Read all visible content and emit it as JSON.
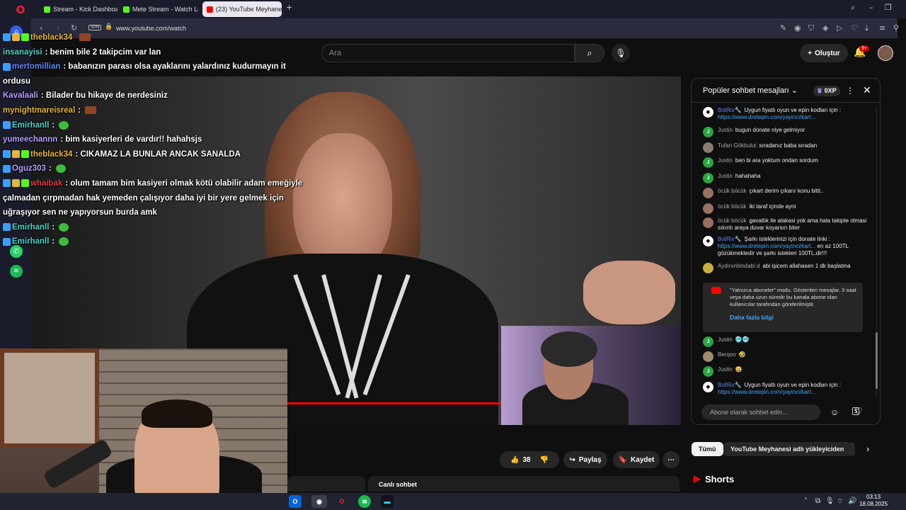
{
  "browser": {
    "tabs": [
      {
        "label": "Stream - Kick Dashboard",
        "favicon_color": "#53fc18"
      },
      {
        "label": "Mete Stream - Watch Live",
        "favicon_color": "#53fc18"
      },
      {
        "label": "(23) YouTube Meyhanesi",
        "favicon_color": "#ff0000"
      }
    ],
    "new_tab": "+",
    "vpn": "VPN",
    "url": "www.youtube.com/watch"
  },
  "youtube": {
    "search_placeholder": "Ara",
    "create_label": "Oluştur",
    "notif_badge": "9+",
    "like_count": "38",
    "share_label": "Paylaş",
    "save_label": "Kaydet",
    "live_chat_label": "Canlı sohbet",
    "pills": [
      "Tümü",
      "YouTube Meyhanesi adlı yükleyiciden"
    ],
    "shorts_label": "Shorts"
  },
  "chat": {
    "title": "Popüler sohbet mesajları",
    "xp": "0XP",
    "input_placeholder": "Abone olarak sohbet edin...",
    "notice": "\"Yalnızca aboneler\" modu. Gösterilen mesajlar, 3 saat veya daha uzun süredir bu kanala abone olan kullanıcılar tarafından gönderilmiştir.",
    "notice_link": "Daha fazla bilgi",
    "messages": [
      {
        "name": "BotRix🔧",
        "text": "Uygun fiyatlı oyun ve epin kodları için : ",
        "link": "https://www.dretepin.com/yayinci/kart...",
        "color": "#ffffff",
        "initial": "◆",
        "bot": true
      },
      {
        "name": "Justin",
        "text": "bugun donate niye gelmiyor",
        "color": "#2ba640",
        "initial": "J"
      },
      {
        "name": "Tufan Gökbulut",
        "text": "sıradanız baba sıradan",
        "color": "#8a7a70",
        "initial": ""
      },
      {
        "name": "Justin",
        "text": "ben bi ara yoktum ondan sordum",
        "color": "#2ba640",
        "initial": "J"
      },
      {
        "name": "Justin",
        "text": "hahahaha",
        "color": "#2ba640",
        "initial": "J"
      },
      {
        "name": "öcük böcük",
        "text": "çıkart derim çıkarır konu bitti..",
        "color": "#9a7060",
        "initial": ""
      },
      {
        "name": "öcük böcük",
        "text": "iki taraf içinde ayni",
        "color": "#9a7060",
        "initial": ""
      },
      {
        "name": "öcük böcük",
        "text": "gavatlık ile alakasi yok ama hala takipte olmasi sıkıntı araya duvar koyarsın biter",
        "color": "#9a7060",
        "initial": ""
      },
      {
        "name": "BotRix🔧",
        "text": "Şarkı isteklerinizi için donate linki : ",
        "link": "https://www.dretepin.com/yayinci/kart...",
        "text2": " en az 100TL gözükmektedir ve şarkı istekleri 100TL.dir!!!",
        "color": "#ffffff",
        "initial": "◆",
        "bot": true
      },
      {
        "name": "Aydınınbindabi d",
        "text": "abi işicem allahasen 1 dk başlatma",
        "color": "#c8b040",
        "initial": ""
      },
      {
        "name": "Justin",
        "text": "🥶🥶",
        "color": "#2ba640",
        "initial": "J"
      },
      {
        "name": "Berqoo",
        "text": "🤣",
        "color": "#a08a70",
        "initial": ""
      },
      {
        "name": "Justin",
        "text": "😀",
        "color": "#2ba640",
        "initial": "J"
      },
      {
        "name": "BotRix🔧",
        "text": "Uygun fiyatlı oyun ve epin kodları için : ",
        "link": "https://www.dretepin.com/yayinci/kart...",
        "color": "#ffffff",
        "initial": "◆",
        "bot": true
      }
    ]
  },
  "overlay_chat": [
    {
      "name": "theblack34",
      "name_color": "#e8b43a",
      "text": "",
      "emote": "brick",
      "badges": 3
    },
    {
      "name": "insanayisi",
      "name_color": "#4fd1c5",
      "text": ": benim bile 2 takipcim var lan"
    },
    {
      "name": "mertomillian",
      "name_color": "#5e84f1",
      "text": ": babanızın parası olsa ayaklarını yalardınız kudurmayın it",
      "badges": 1
    },
    {
      "name": "",
      "name_color": "#ffffff",
      "text": "ordusu"
    },
    {
      "name": "Kavalaali",
      "name_color": "#b79cff",
      "text": ": Bilader bu hikaye de nerdesiniz"
    },
    {
      "name": "mynightmareisreal",
      "name_color": "#e8b43a",
      "text": ":",
      "emote": "brick"
    },
    {
      "name": "Emirhanll",
      "name_color": "#4fd1c5",
      "text": ":",
      "emote": "green",
      "badges": 1
    },
    {
      "name": "yumeechannn",
      "name_color": "#b79cff",
      "text": ": bim kasiyerleri de vardır!! hahahsjs"
    },
    {
      "name": "theblack34",
      "name_color": "#e8b43a",
      "text": ": CIKAMAZ LA BUNLAR ANCAK SANALDA",
      "badges": 3
    },
    {
      "name": "Oguz303",
      "name_color": "#b79cff",
      "text": ":",
      "emote": "green",
      "badges": 1
    },
    {
      "name": "whaibak",
      "name_color": "#e63946",
      "text": ": olum tamam bim kasiyeri olmak kötü olabilir adam emeğiyle",
      "badges": 3
    },
    {
      "name": "",
      "name_color": "#ffffff",
      "text": "çalmadan çırpmadan hak yemeden çalışıyor daha iyi bir yere gelmek için"
    },
    {
      "name": "",
      "name_color": "#ffffff",
      "text": "uğraşıyor sen ne yapıyorsun burda amk"
    },
    {
      "name": "Emirhanll",
      "name_color": "#4fd1c5",
      "text": ":",
      "emote": "green",
      "badges": 1
    },
    {
      "name": "Emirhanll",
      "name_color": "#4fd1c5",
      "text": ":",
      "emote": "green",
      "badges": 1
    }
  ],
  "taskbar": {
    "time": "03:13",
    "date": "18.08.2025"
  }
}
